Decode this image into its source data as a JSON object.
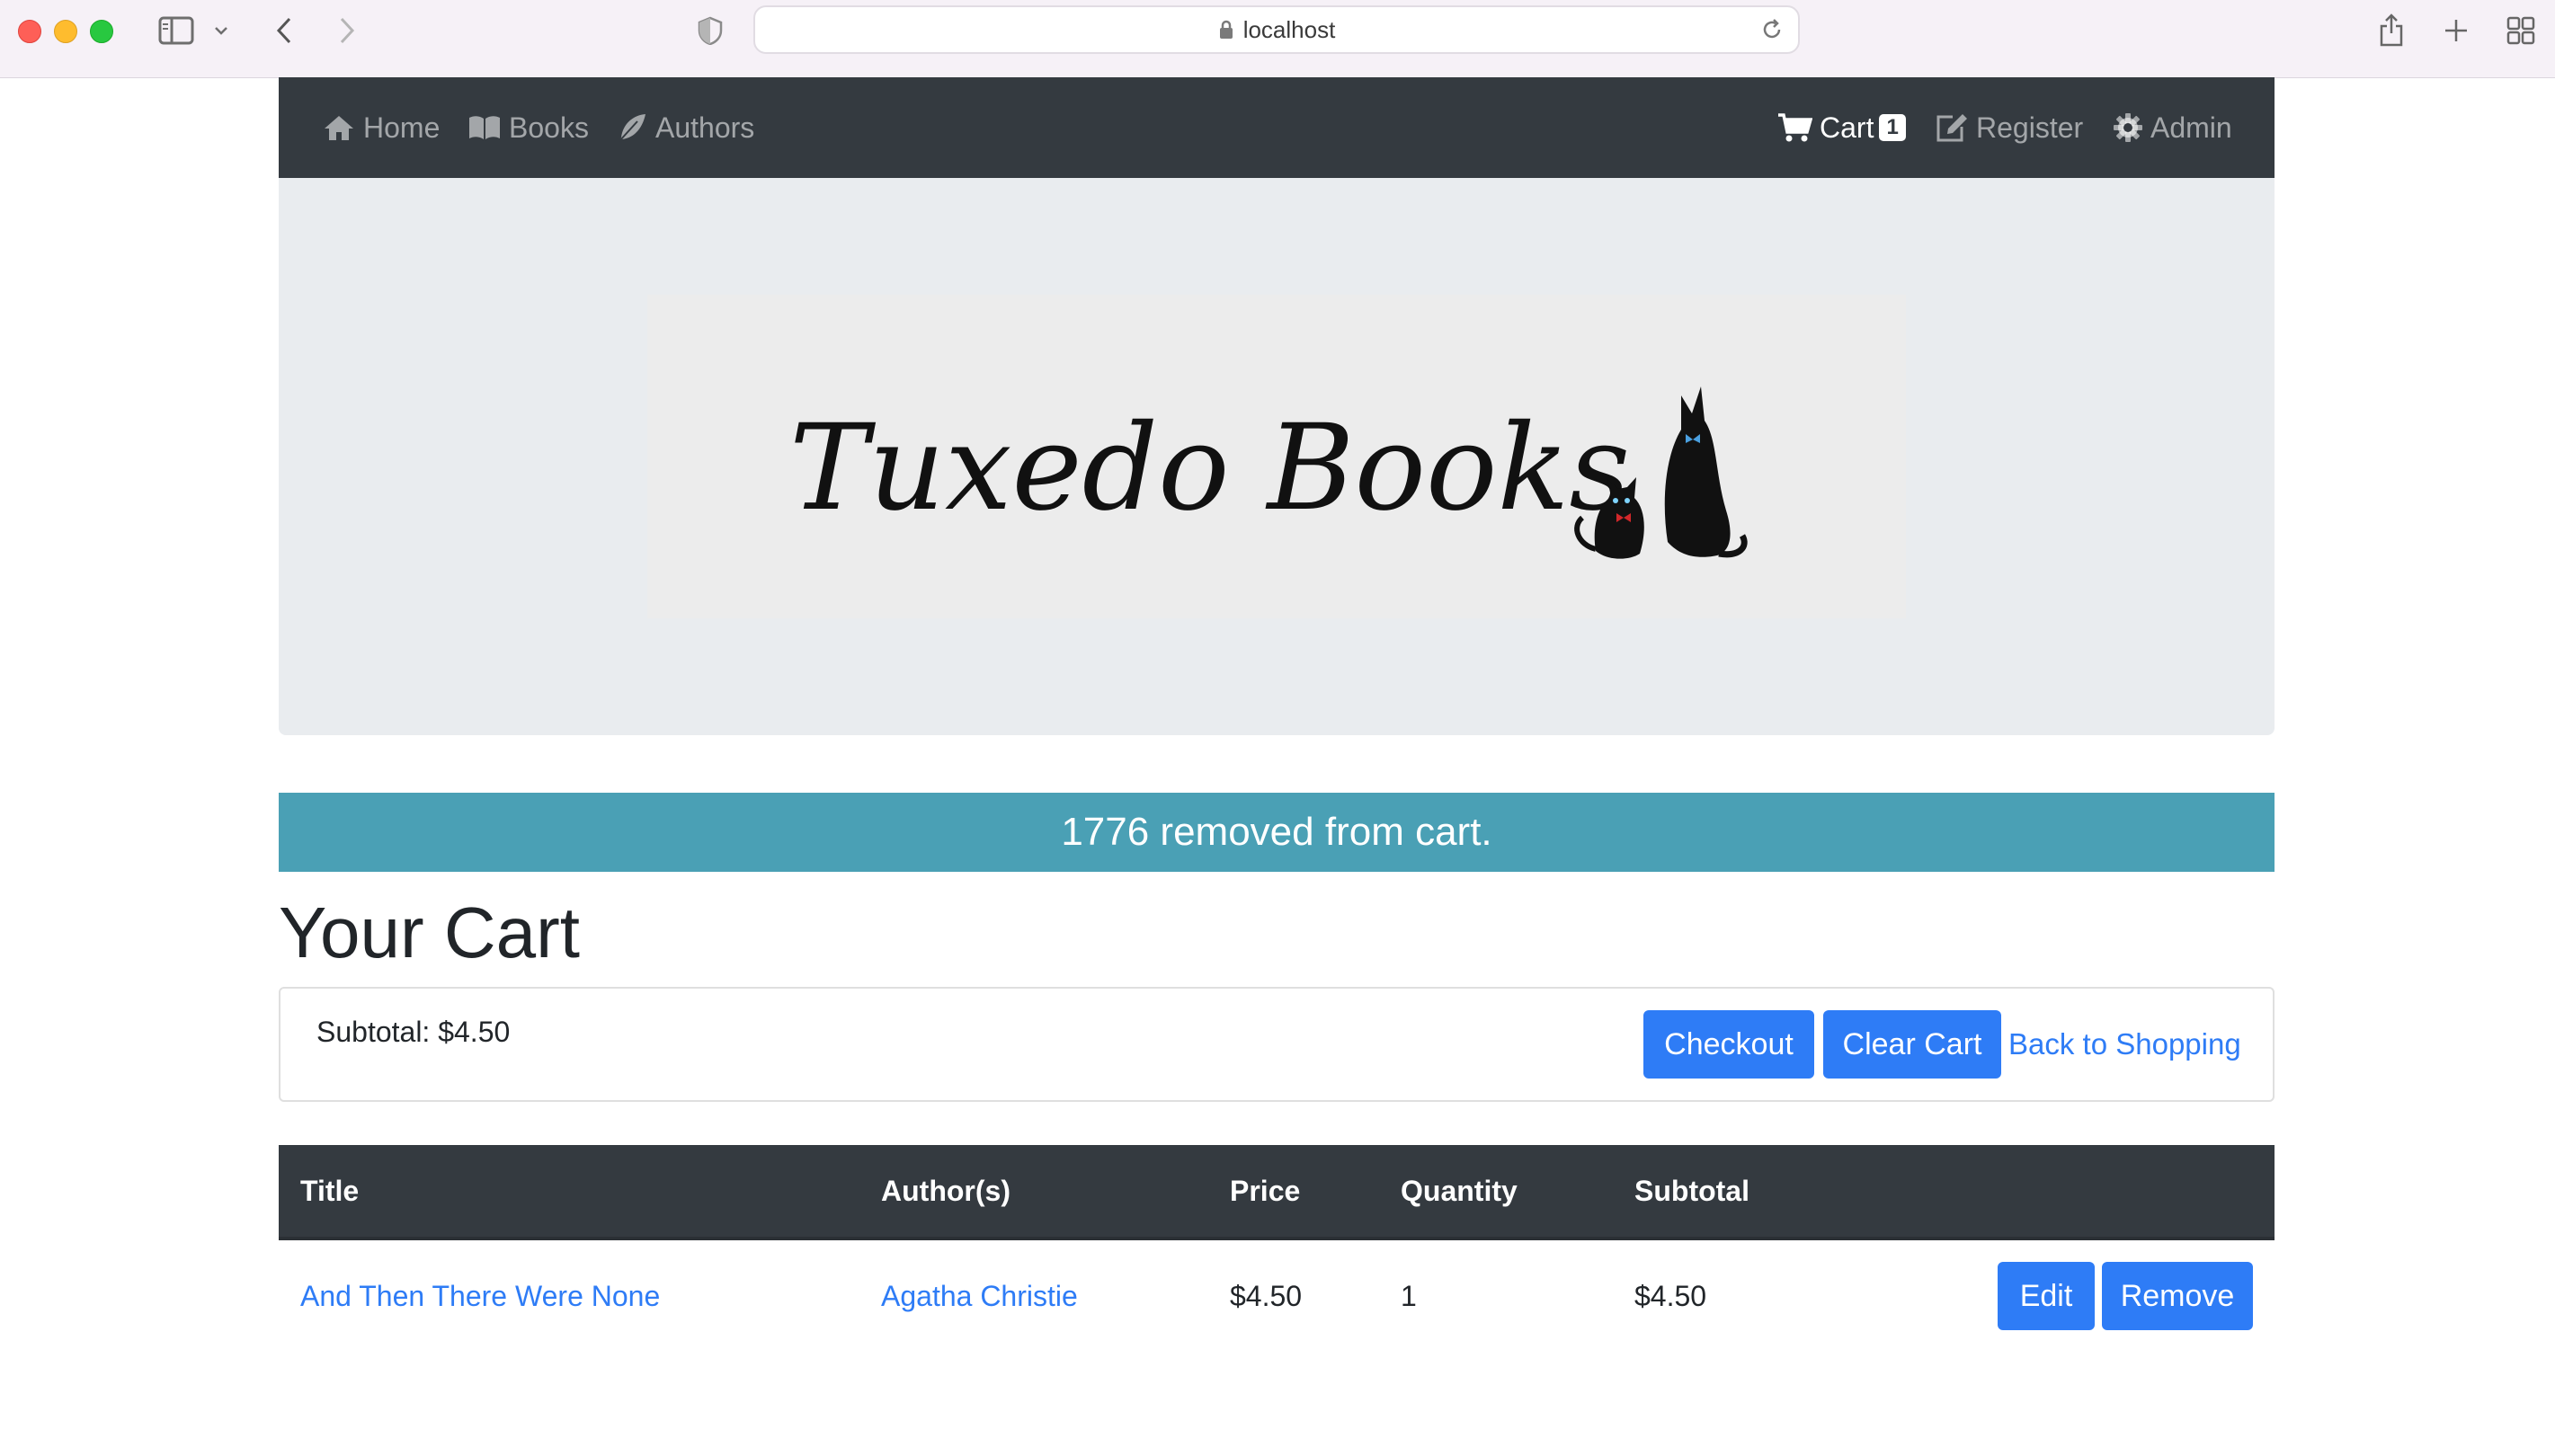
{
  "browser": {
    "url": "localhost"
  },
  "nav": {
    "home": "Home",
    "books": "Books",
    "authors": "Authors",
    "cart": "Cart",
    "cart_count": "1",
    "register": "Register",
    "admin": "Admin"
  },
  "banner": {
    "logo_text": "Tuxedo Books"
  },
  "alert": {
    "message": "1776 removed from cart."
  },
  "page": {
    "title": "Your Cart"
  },
  "summary": {
    "subtotal": "Subtotal: $4.50",
    "checkout_label": "Checkout",
    "clear_label": "Clear Cart",
    "back_label": "Back to Shopping"
  },
  "table": {
    "headers": [
      "Title",
      "Author(s)",
      "Price",
      "Quantity",
      "Subtotal"
    ],
    "rows": [
      {
        "title": "And Then There Were None",
        "author": "Agatha Christie",
        "price": "$4.50",
        "quantity": "1",
        "subtotal": "$4.50",
        "edit_label": "Edit",
        "remove_label": "Remove"
      }
    ]
  },
  "colors": {
    "navbar": "#343a40",
    "primary": "#2e7cf6",
    "alert_info": "#4aa0b5",
    "jumbotron": "#e9ecef"
  },
  "icons": {
    "nav_home": "home-icon",
    "nav_books": "book-icon",
    "nav_authors": "feather-icon",
    "nav_cart": "shopping-cart-icon",
    "nav_register": "edit-icon",
    "nav_admin": "gear-icon"
  }
}
